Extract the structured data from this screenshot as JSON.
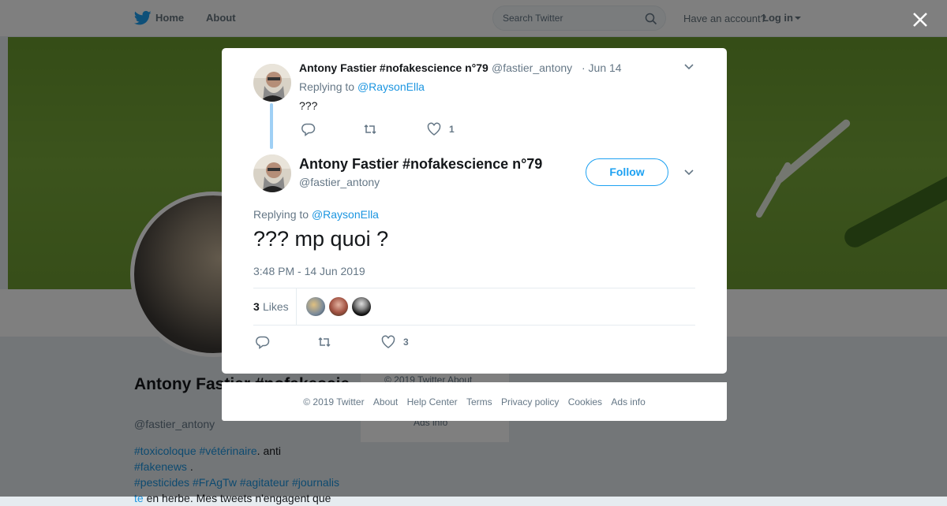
{
  "topnav": {
    "home_label": "Home",
    "about_label": "About",
    "search_placeholder": "Search Twitter",
    "account_question": "Have an account?",
    "login_label": "Log in"
  },
  "profile": {
    "name": "Antony Fastier #nofakescie",
    "handle": "@fastier_antony",
    "bio_tags1": [
      "#toxicoloque",
      "#vétérinaire"
    ],
    "bio_text1": ". anti",
    "bio_tag2": "#fakenews",
    "bio_text2": " .",
    "bio_tags3": [
      "#pesticides",
      "#FrAgTw",
      "#agitateur",
      "#journalis"
    ],
    "bio_tag4": "te",
    "bio_text4": " en herbe. Mes tweets n'engagent que",
    "sidecard_copyright": "© 2019 Twitter   About",
    "sidecard_ads": "Ads info"
  },
  "parent_tweet": {
    "name": "Antony Fastier #nofakescience n°79",
    "handle": "@fastier_antony",
    "date": "· Jun 14",
    "replying_prefix": "Replying to ",
    "replying_to": "@RaysonElla",
    "text": "???",
    "likes": "1"
  },
  "main_tweet": {
    "name": "Antony Fastier #nofakescience n°79",
    "handle": "@fastier_antony",
    "follow_label": "Follow",
    "replying_prefix": "Replying to ",
    "replying_to": "@RaysonElla",
    "text": "??? mp quoi ?",
    "timestamp": "3:48 PM - 14 Jun 2019",
    "likes_count": "3",
    "likes_label": "Likes",
    "action_likes": "3"
  },
  "footer": {
    "items": [
      "© 2019 Twitter",
      "About",
      "Help Center",
      "Terms",
      "Privacy policy",
      "Cookies",
      "Ads info"
    ]
  },
  "colors": {
    "accent": "#1da1f2",
    "link": "#1b95e0",
    "muted": "#657786",
    "thread_line": "#9fd0f5"
  }
}
